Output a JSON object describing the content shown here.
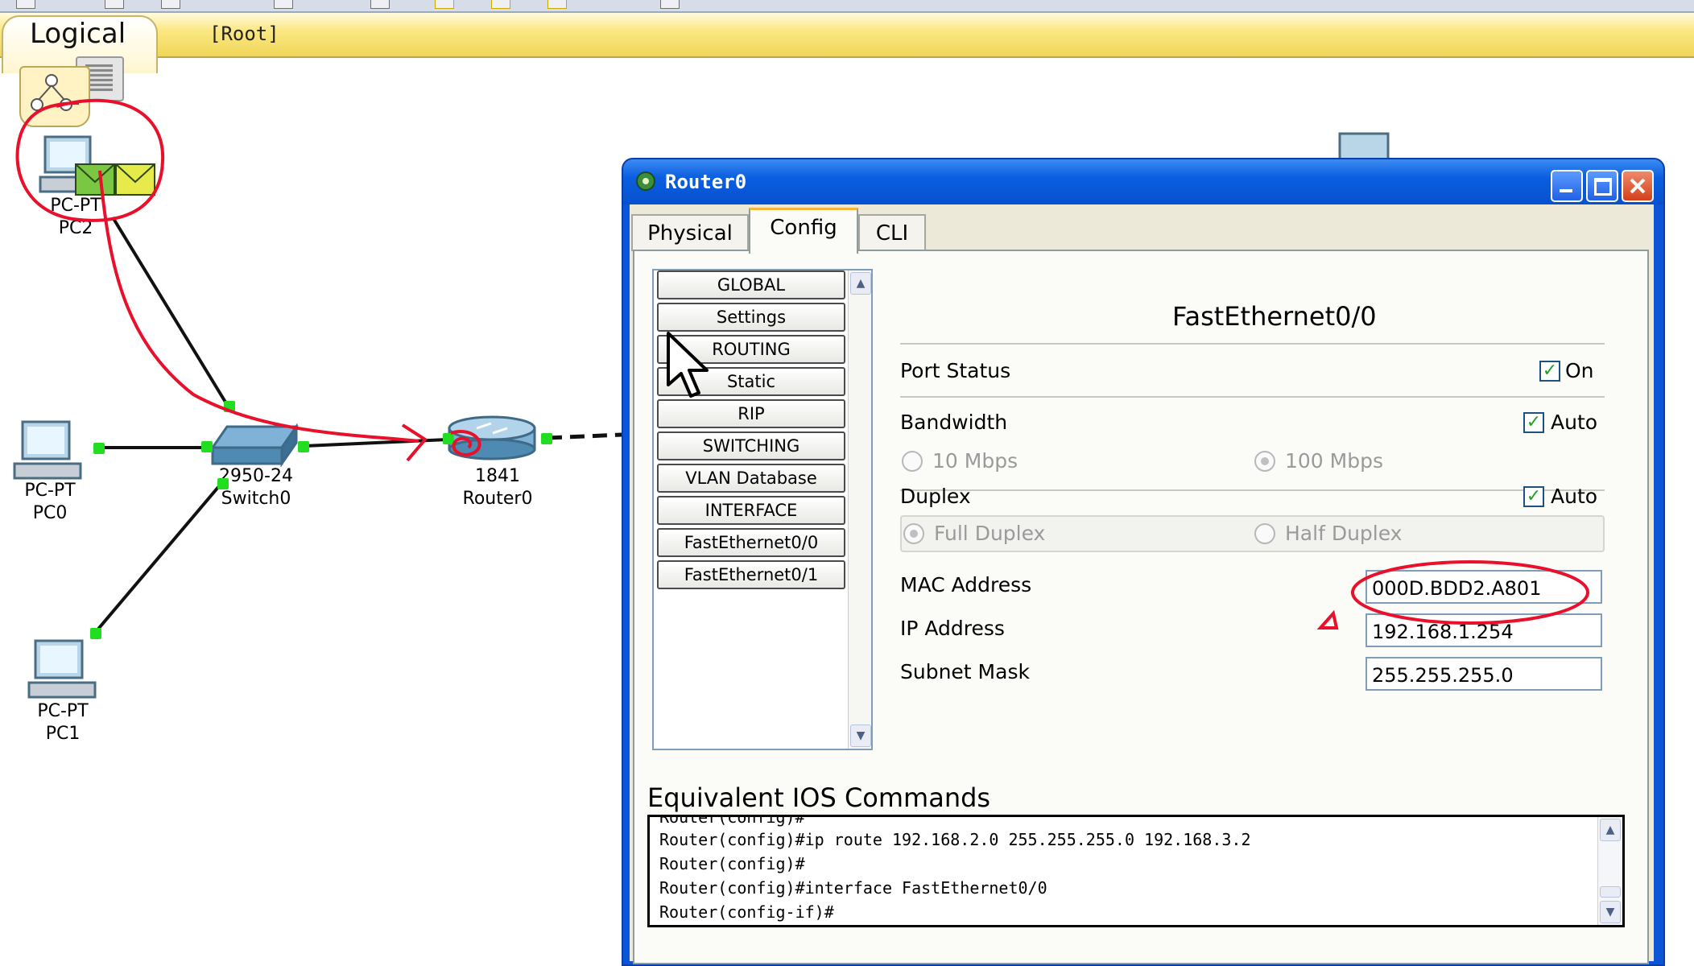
{
  "workspace": {
    "logical_label": "Logical",
    "root_label": "[Root]"
  },
  "devices": {
    "pc2": {
      "type": "PC-PT",
      "name": "PC2"
    },
    "pc0": {
      "type": "PC-PT",
      "name": "PC0"
    },
    "pc1": {
      "type": "PC-PT",
      "name": "PC1"
    },
    "switch0": {
      "type": "2950-24",
      "name": "Switch0"
    },
    "router0": {
      "type": "1841",
      "name": "Router0"
    }
  },
  "router_window": {
    "title": "Router0",
    "tabs": [
      {
        "label": "Physical"
      },
      {
        "label": "Config"
      },
      {
        "label": "CLI"
      }
    ],
    "active_tab": "Config",
    "sidebar": {
      "items": [
        {
          "label": "GLOBAL"
        },
        {
          "label": "Settings"
        },
        {
          "label": "ROUTING"
        },
        {
          "label": "Static"
        },
        {
          "label": "RIP"
        },
        {
          "label": "SWITCHING"
        },
        {
          "label": "VLAN Database"
        },
        {
          "label": "INTERFACE"
        },
        {
          "label": "FastEthernet0/0"
        },
        {
          "label": "FastEthernet0/1"
        }
      ]
    },
    "interface": {
      "title": "FastEthernet0/0",
      "port_status_label": "Port Status",
      "port_status_value": "On",
      "port_status_checked": true,
      "bandwidth_label": "Bandwidth",
      "bandwidth_auto_label": "Auto",
      "bandwidth_auto_checked": true,
      "bandwidth_options": [
        "10 Mbps",
        "100 Mbps"
      ],
      "bandwidth_selected": "100 Mbps",
      "duplex_label": "Duplex",
      "duplex_auto_label": "Auto",
      "duplex_auto_checked": true,
      "duplex_options": [
        "Full Duplex",
        "Half Duplex"
      ],
      "duplex_selected": "Full Duplex",
      "mac_label": "MAC Address",
      "mac_value": "000D.BDD2.A801",
      "ip_label": "IP Address",
      "ip_value": "192.168.1.254",
      "mask_label": "Subnet Mask",
      "mask_value": "255.255.255.0"
    },
    "ios": {
      "title": "Equivalent IOS Commands",
      "lines": [
        "Router(config)#",
        "Router(config)#ip route 192.168.2.0 255.255.255.0 192.168.3.2",
        "Router(config)#",
        "Router(config)#interface FastEthernet0/0",
        "Router(config-if)#"
      ]
    }
  },
  "colors": {
    "annotation_red": "#e8102a",
    "link_active": "#22dd22",
    "title_bar": "#0a5fe0"
  }
}
